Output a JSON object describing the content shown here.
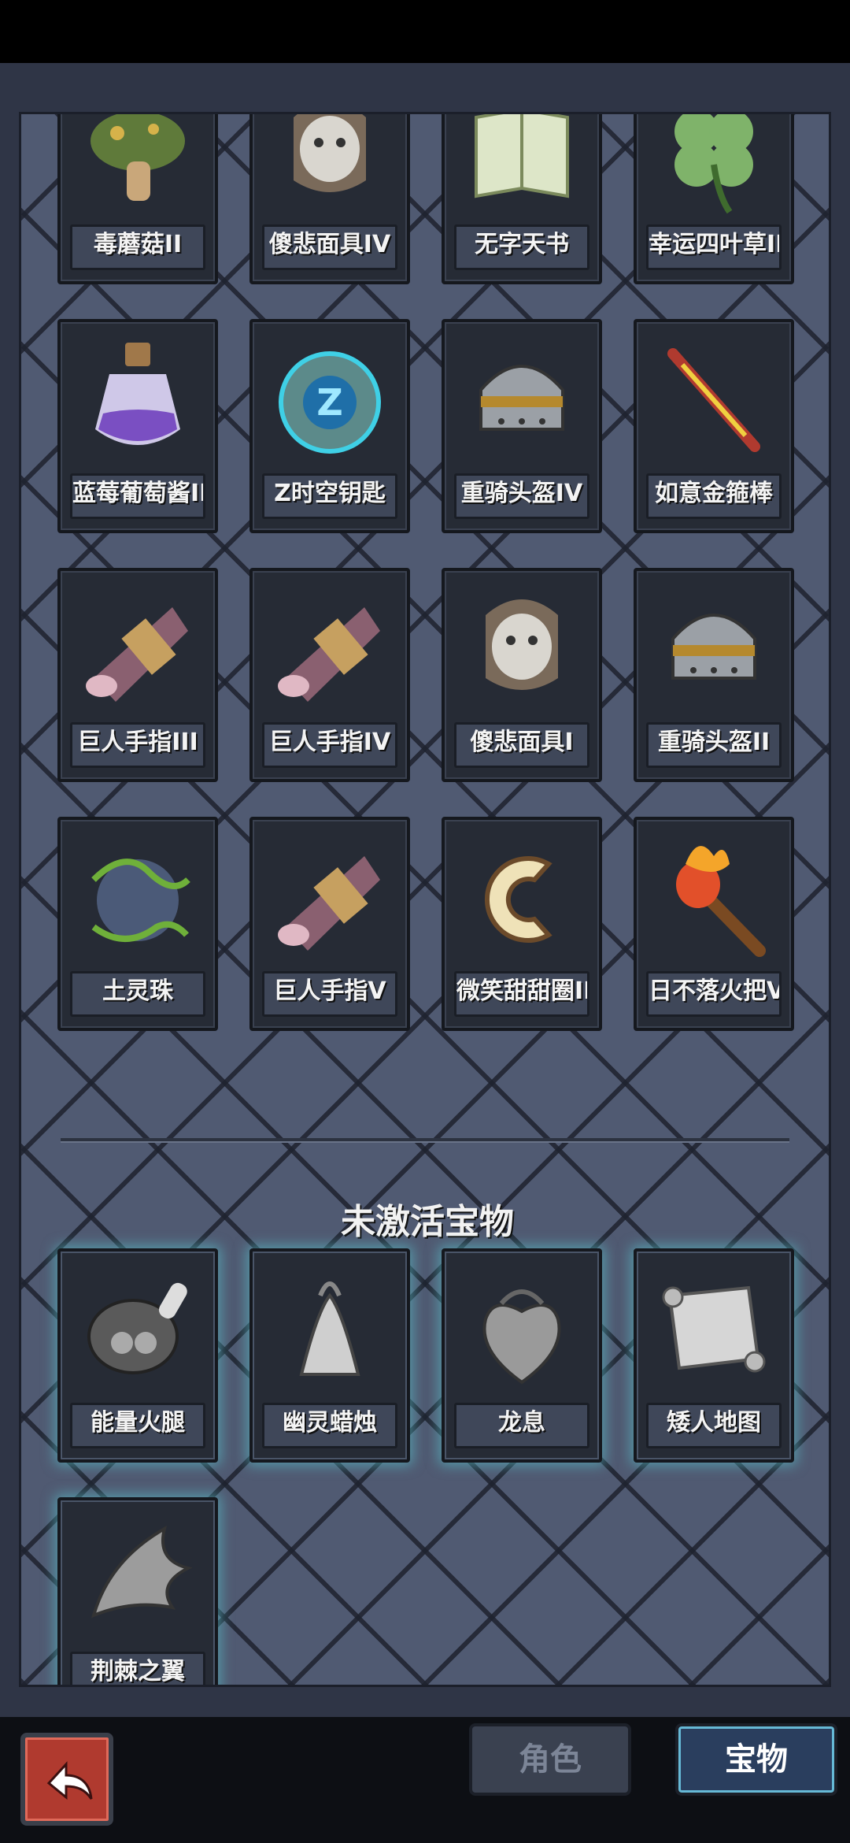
{
  "active_items": [
    {
      "label": "毒蘑菇II",
      "icon": "poison-mushroom-icon"
    },
    {
      "label": "傻悲面具IV",
      "icon": "sad-mask-icon"
    },
    {
      "label": "无字天书",
      "icon": "blank-book-icon"
    },
    {
      "label": "幸运四叶草II",
      "icon": "four-leaf-clover-icon"
    },
    {
      "label": "蓝莓葡萄酱II",
      "icon": "purple-potion-icon"
    },
    {
      "label": "Z时空钥匙",
      "icon": "z-orb-icon"
    },
    {
      "label": "重骑头盔IV",
      "icon": "knight-helmet-icon"
    },
    {
      "label": "如意金箍棒",
      "icon": "golden-staff-icon"
    },
    {
      "label": "巨人手指III",
      "icon": "giant-finger-icon"
    },
    {
      "label": "巨人手指IV",
      "icon": "giant-finger-icon"
    },
    {
      "label": "傻悲面具I",
      "icon": "sad-mask-icon"
    },
    {
      "label": "重骑头盔II",
      "icon": "knight-helmet-icon"
    },
    {
      "label": "土灵珠",
      "icon": "earth-orb-icon"
    },
    {
      "label": "巨人手指V",
      "icon": "giant-finger-icon"
    },
    {
      "label": "微笑甜甜圈II",
      "icon": "donut-icon"
    },
    {
      "label": "日不落火把V",
      "icon": "torch-icon"
    }
  ],
  "inactive_section_title": "未激活宝物",
  "inactive_items": [
    {
      "label": "能量火腿",
      "icon": "ham-icon"
    },
    {
      "label": "幽灵蜡烛",
      "icon": "ghost-candle-icon"
    },
    {
      "label": "龙息",
      "icon": "dragon-heart-icon"
    },
    {
      "label": "矮人地图",
      "icon": "scroll-map-icon"
    },
    {
      "label": "荆棘之翼",
      "icon": "thorn-wing-icon"
    }
  ],
  "tabs": {
    "role": "角色",
    "treasure": "宝物"
  },
  "colors": {
    "panel": "#505a72",
    "active_tab": "#2a3e5e",
    "glow": "#5ac8d2"
  }
}
